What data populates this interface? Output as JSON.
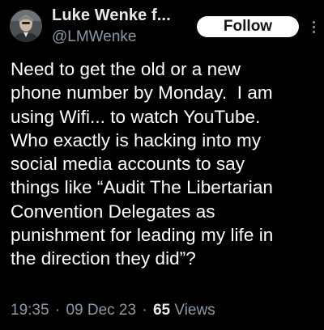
{
  "author": {
    "display_name": "Luke Wenke f...",
    "handle": "@LMWenke"
  },
  "follow_button": {
    "label": "Follow"
  },
  "tweet": {
    "text": "Need to get the old or a new\nphone number by Monday.  I am\nusing Wifi... to watch YouTube.\nWho exactly is hacking into my\nsocial media accounts to say\nthings like “Audit The Libertarian\nConvention Delegates as\npunishment for leading my life in\nthe direction they did”?",
    "time": "19:35",
    "separator": "·",
    "date": "09 Dec 23",
    "views_count": "65",
    "views_label": "Views"
  },
  "icons": {
    "avatar": "profile-photo",
    "more": "more-options-icon"
  },
  "colors": {
    "background": "#000000",
    "text": "#ffffff",
    "muted": "#8b98a5",
    "button_bg": "#ffffff",
    "button_text": "#0f1419"
  }
}
